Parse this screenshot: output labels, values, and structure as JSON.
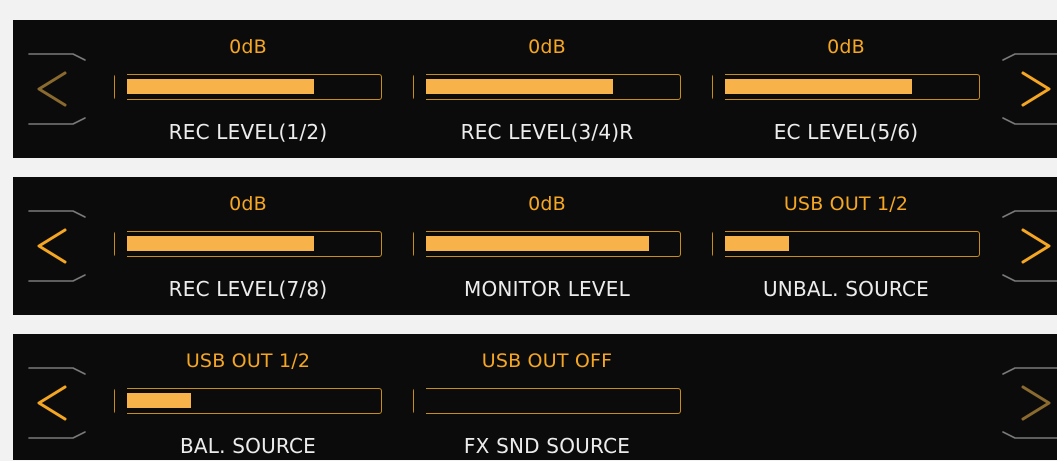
{
  "colors": {
    "accent": "#f5a623",
    "meter_fill": "#f7b24a",
    "meter_border": "#c98d1c",
    "panel_bg": "#0b0b0b",
    "label_text": "#ececec",
    "arrow_inactive": "#7a7a7a"
  },
  "panels": [
    {
      "nav_left": {
        "icon": "chevron-left-icon",
        "active": false
      },
      "nav_right": {
        "icon": "chevron-right-icon",
        "active": true
      },
      "slots": [
        {
          "value": "0dB",
          "label": "REC LEVEL(1/2)",
          "level": 0.76
        },
        {
          "value": "0dB",
          "label": "REC LEVEL(3/4)R",
          "level": 0.76
        },
        {
          "value": "0dB",
          "label": "EC LEVEL(5/6)",
          "level": 0.76
        }
      ]
    },
    {
      "nav_left": {
        "icon": "chevron-left-icon",
        "active": true
      },
      "nav_right": {
        "icon": "chevron-right-icon",
        "active": true
      },
      "slots": [
        {
          "value": "0dB",
          "label": "REC LEVEL(7/8)",
          "level": 0.76
        },
        {
          "value": "0dB",
          "label": "MONITOR LEVEL",
          "level": 0.9
        },
        {
          "value": "USB OUT 1/2",
          "label": "UNBAL. SOURCE",
          "level": 0.28
        }
      ]
    },
    {
      "nav_left": {
        "icon": "chevron-left-icon",
        "active": true
      },
      "nav_right": {
        "icon": "chevron-right-icon",
        "active": false
      },
      "slots": [
        {
          "value": "USB OUT 1/2",
          "label": "BAL. SOURCE",
          "level": 0.28
        },
        {
          "value": "USB OUT OFF",
          "label": "FX SND SOURCE",
          "level": 0.0
        }
      ]
    }
  ]
}
